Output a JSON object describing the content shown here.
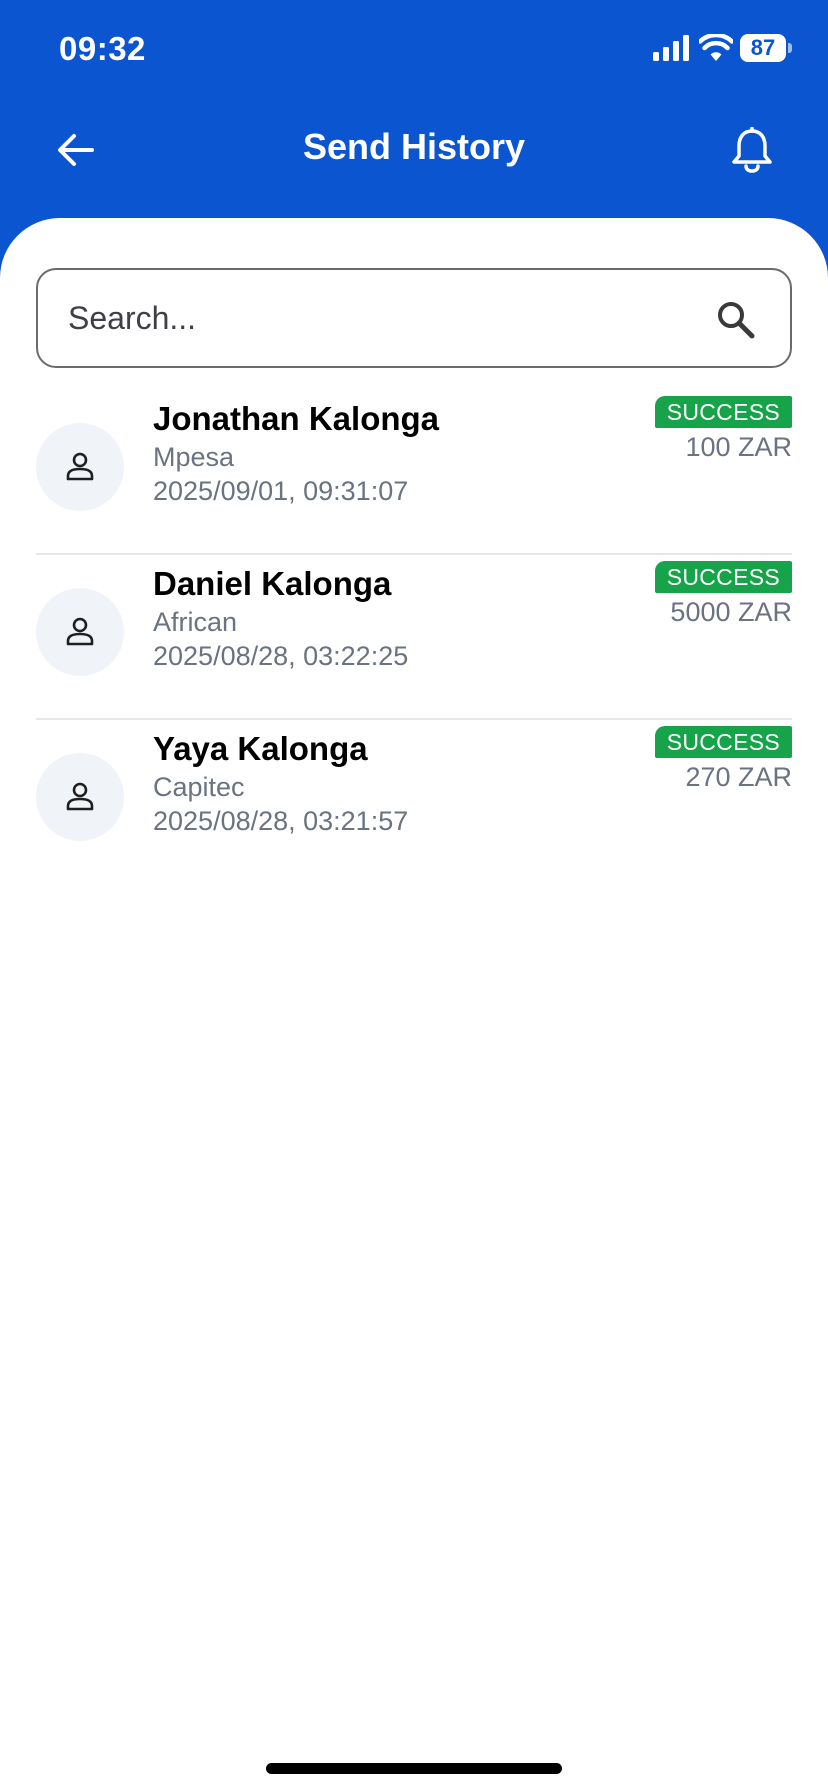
{
  "status_bar": {
    "time": "09:32",
    "battery": "87"
  },
  "header": {
    "title": "Send History",
    "back_icon": "arrow-left-icon",
    "notification_icon": "bell-icon"
  },
  "search": {
    "placeholder": "Search...",
    "value": "",
    "icon": "search-icon"
  },
  "transactions": [
    {
      "name": "Jonathan Kalonga",
      "method": "Mpesa",
      "date": "2025/09/01, 09:31:07",
      "status": "SUCCESS",
      "amount": "100 ZAR"
    },
    {
      "name": "Daniel Kalonga",
      "method": "African",
      "date": "2025/08/28, 03:22:25",
      "status": "SUCCESS",
      "amount": "5000 ZAR"
    },
    {
      "name": "Yaya Kalonga",
      "method": "Capitec",
      "date": "2025/08/28, 03:21:57",
      "status": "SUCCESS",
      "amount": "270 ZAR"
    }
  ],
  "colors": {
    "header_bg": "#0b55d1",
    "success": "#16a34a",
    "muted_text": "#6b7280",
    "avatar_bg": "#f0f3f8"
  }
}
